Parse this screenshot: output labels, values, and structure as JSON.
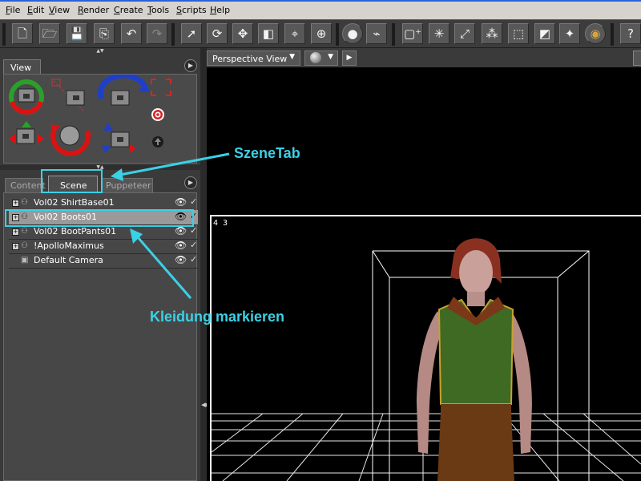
{
  "menu": [
    "File",
    "Edit",
    "View",
    "Render",
    "Create",
    "Tools",
    "Scripts",
    "Help"
  ],
  "toolbar": {
    "icons": [
      "new-document-icon",
      "open-folder-icon",
      "save-icon",
      "copy-icon",
      "undo-icon",
      "redo-icon",
      "select-arrow-icon",
      "rotate-icon",
      "translate-icon",
      "scale-icon",
      "camera-icon",
      "sphere-grid-icon",
      "sphere-material-icon",
      "bone-icon",
      "add-box-icon",
      "add-light-icon",
      "add-arrow-icon",
      "add-scatter-icon",
      "add-dotted-icon",
      "add-cube-icon",
      "add-star-icon",
      "globe-icon",
      "help-icon"
    ]
  },
  "view_panel": {
    "tab": "View"
  },
  "scene_panel": {
    "tabs": [
      "Content",
      "Scene",
      "Puppeteer"
    ],
    "active_tab": "Scene",
    "items": [
      {
        "label": "Vol02 ShirtBase01",
        "selected": false
      },
      {
        "label": "Vol02 Boots01",
        "selected": true
      },
      {
        "label": "Vol02 BootPants01",
        "selected": false
      },
      {
        "label": "!ApolloMaximus",
        "selected": false
      },
      {
        "label": "Default Camera",
        "selected": false
      }
    ]
  },
  "viewport": {
    "view_dropdown": "Perspective View",
    "frame_label": "4 3"
  },
  "annotations": {
    "scene_tab": "SzeneTab",
    "mark_clothing": "Kleidung markieren"
  },
  "colors": {
    "annotation": "#3ad1e6",
    "selection_highlight": "#9a9a9a"
  }
}
